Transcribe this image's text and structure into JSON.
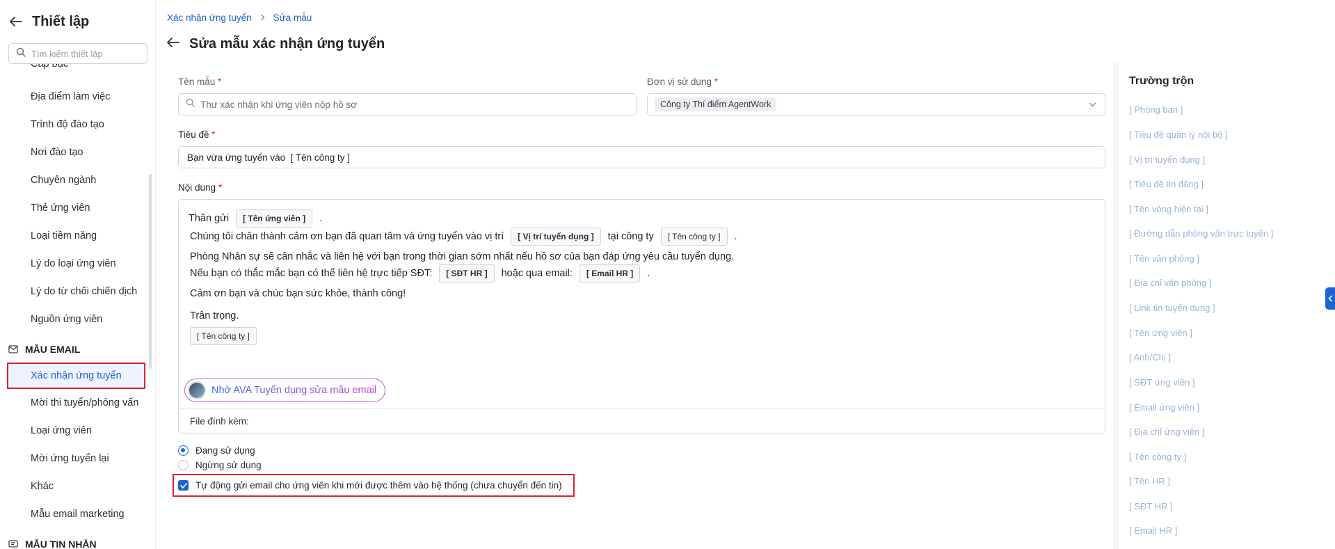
{
  "sidebar": {
    "title": "Thiết lập",
    "search_placeholder": "Tìm kiếm thiết lập",
    "items": [
      {
        "label": "Cấp bậc"
      },
      {
        "label": "Địa điểm làm việc"
      },
      {
        "label": "Trình độ đào tạo"
      },
      {
        "label": "Nơi đào tạo"
      },
      {
        "label": "Chuyên ngành"
      },
      {
        "label": "Thẻ ứng viên"
      },
      {
        "label": "Loại tiềm năng"
      },
      {
        "label": "Lý do loại ứng viên"
      },
      {
        "label": "Lý do từ chối chiến dịch"
      },
      {
        "label": "Nguồn ứng viên"
      }
    ],
    "email_group": "MẪU EMAIL",
    "email_items": [
      {
        "label": "Xác nhận ứng tuyển"
      },
      {
        "label": "Mời thi tuyển/phỏng vấn"
      },
      {
        "label": "Loại ứng viên"
      },
      {
        "label": "Mời ứng tuyển lại"
      },
      {
        "label": "Khác"
      },
      {
        "label": "Mẫu email marketing"
      }
    ],
    "sms_group": "MẪU TIN NHẮN"
  },
  "breadcrumb": [
    "Xác nhận ứng tuyển",
    "Sửa mẫu"
  ],
  "page_title": "Sửa mẫu xác nhận ứng tuyển",
  "form": {
    "template_name_label": "Tên mẫu",
    "template_name_placeholder": "Thư xác nhận khi ứng viên nộp hồ sơ",
    "unit_label": "Đơn vị sử dụng",
    "unit_value": "Công ty Thí điểm AgentWork",
    "subject_label": "Tiêu đề",
    "subject_value": "Bạn vừa ứng tuyển vào  [ Tên công ty ]",
    "content_label": "Nội dung",
    "content": {
      "line1_text": "Thân gửi",
      "line1_tag": "[ Tên ứng viên ]",
      "line2_text_a": "Chúng tôi chân thành cảm ơn bạn đã quan tâm và ứng tuyển vào vị trí",
      "line2_tag_a": "[ Vị trí tuyển dụng ]",
      "line2_text_b": "tại công ty",
      "line2_tag_b": "[ Tên công ty ]",
      "line3_text": "Phòng Nhân sự sẽ cân nhắc và liên hệ với bạn trong thời gian sớm nhất nếu hồ sơ của bạn đáp ứng yêu cầu tuyển dụng.",
      "line4_text_a": "Nếu bạn có thắc mắc bạn có thể liên hệ trực tiếp SĐT:",
      "line4_tag_a": "[ SĐT HR ]",
      "line4_text_b": "hoặc qua email:",
      "line4_tag_b": "[ Email HR ]",
      "line5_text": "Cảm ơn bạn và chúc bạn sức khỏe, thành công!",
      "line6_text": "Trân trọng.",
      "line7_tag": "[ Tên công ty ]",
      "period": "."
    },
    "ai_button": "Nhờ AVA Tuyển dụng sửa mẫu email",
    "attachment_label": "File đính kèm:",
    "status_active": "Đang sử dụng",
    "status_inactive": "Ngừng sử dụng",
    "auto_send_label": "Tự động gửi email cho ứng viên khi mới được thêm vào hệ thống (chưa chuyển đến tin)",
    "auto_send_checked": true
  },
  "merge_fields": {
    "title": "Trường trộn",
    "items": [
      "[ Phòng ban ]",
      "[ Tiêu đề quản lý nội bộ ]",
      "[ Vị trí tuyển dụng ]",
      "[ Tiêu đề tin đăng ]",
      "[ Tên vòng hiện tại ]",
      "[ Đường dẫn phỏng vấn trực tuyến ]",
      "[ Tên văn phòng ]",
      "[ Địa chỉ văn phòng ]",
      "[ Link tin tuyển dụng ]",
      "[ Tên ứng viên ]",
      "[ Anh/Chị ]",
      "[ SĐT ứng viên ]",
      "[ Email ứng viên ]",
      "[ Địa chỉ ứng viên ]",
      "[ Tên công ty ]",
      "[ Tên HR ]",
      "[ SĐT HR ]",
      "[ Email HR ]"
    ]
  },
  "colors": {
    "accent": "#1c64d6",
    "highlight_border": "#e0202a",
    "required": "#e0202a"
  }
}
